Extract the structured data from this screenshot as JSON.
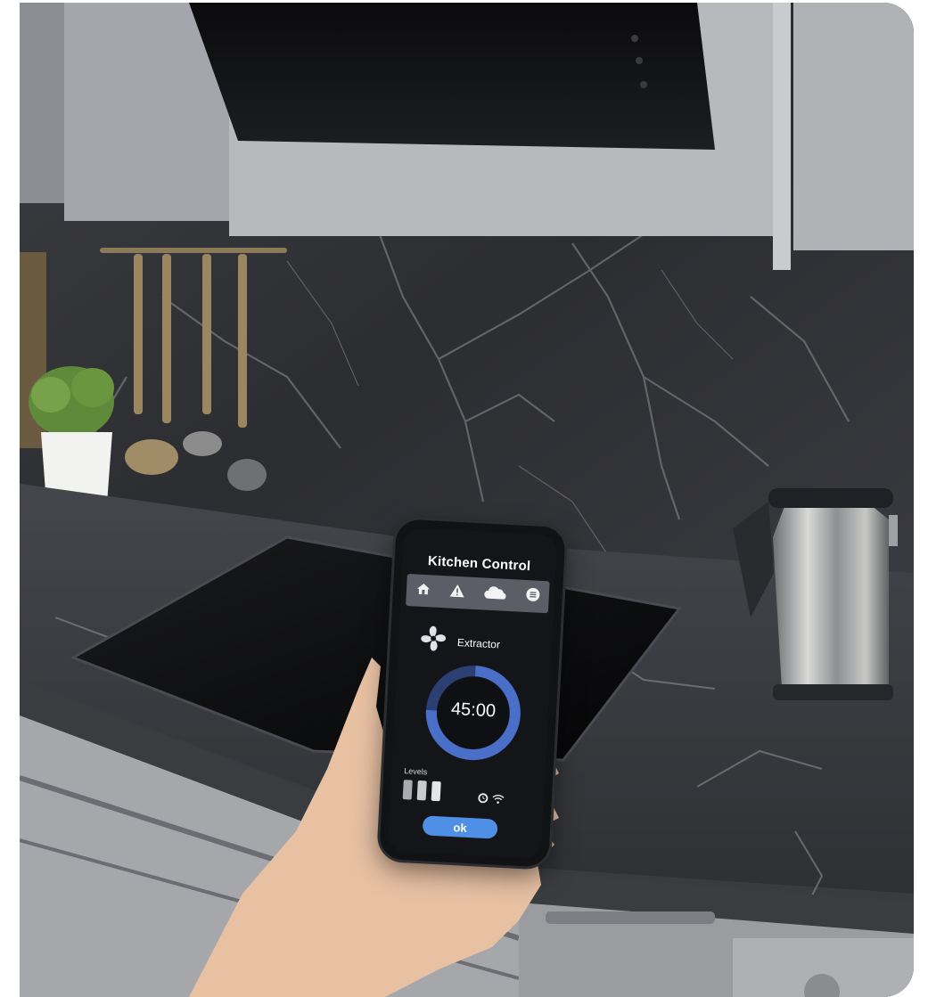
{
  "app": {
    "title": "Kitchen Control",
    "nav_icons": [
      "home-icon",
      "warning-icon",
      "cloud-icon",
      "menu-icon"
    ],
    "device": {
      "icon": "fan-icon",
      "label": "Extractor"
    },
    "timer": {
      "value": "45:00",
      "progress": 0.75
    },
    "levels": {
      "label": "Levels",
      "count": 3
    },
    "status_icons": [
      "clock-icon",
      "wifi-icon"
    ],
    "ok_label": "ok"
  },
  "colors": {
    "accent": "#4f8fe6",
    "ring": "#4a6fc9",
    "ring_bg": "#2c3f73",
    "nav_bar": "#5b5e66",
    "screen_bg": "#141518"
  }
}
